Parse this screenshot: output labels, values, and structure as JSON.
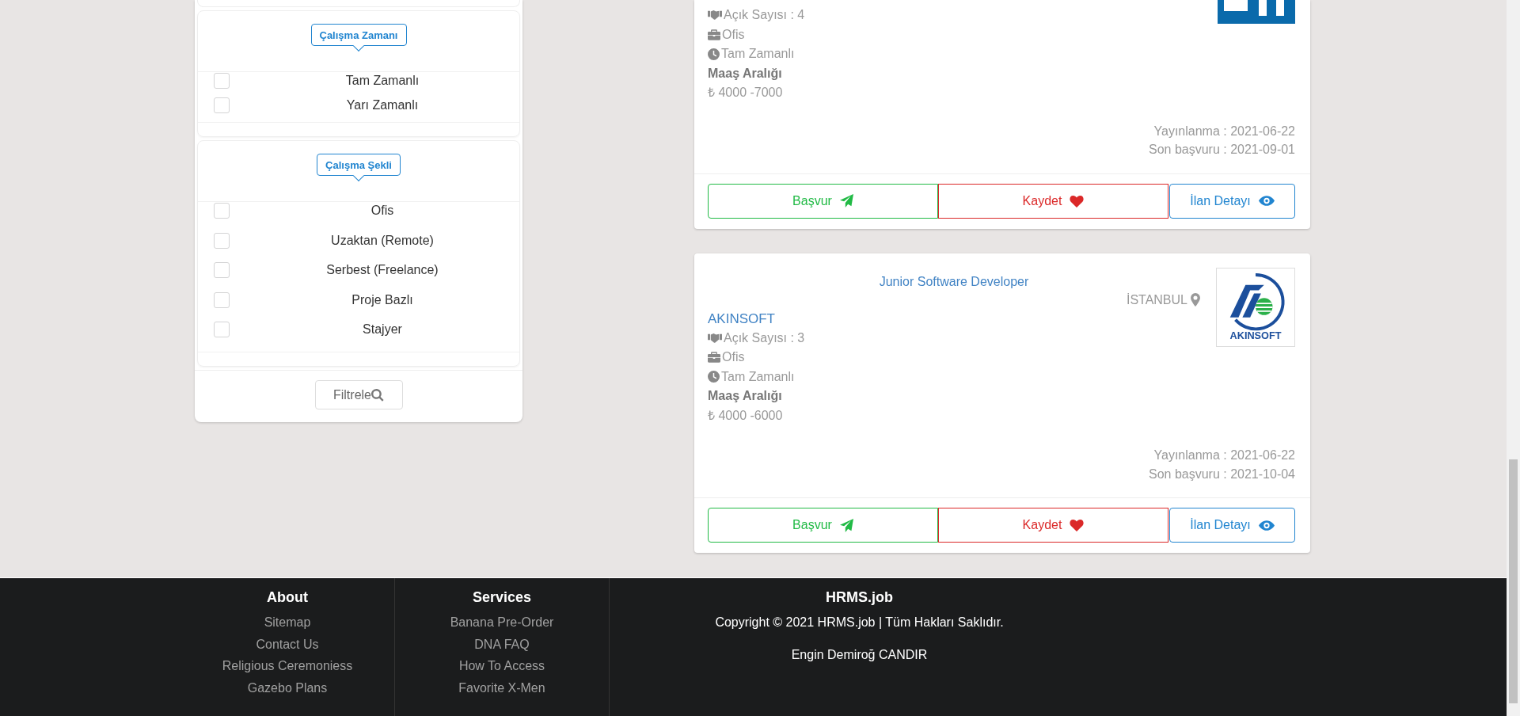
{
  "filters": {
    "sections": [
      {
        "title": "Çalışma Zamanı",
        "options": [
          {
            "label": "Tam Zamanlı",
            "checked": false
          },
          {
            "label": "Yarı Zamanlı",
            "checked": false
          }
        ]
      },
      {
        "title": "Çalışma Şekli",
        "options": [
          {
            "label": "Ofis",
            "checked": false
          },
          {
            "label": "Uzaktan (Remote)",
            "checked": false
          },
          {
            "label": "Serbest (Freelance)",
            "checked": false
          },
          {
            "label": "Proje Bazlı",
            "checked": false
          },
          {
            "label": "Stajyer",
            "checked": false
          }
        ]
      }
    ],
    "filter_button": "Filtrele"
  },
  "jobs": [
    {
      "logo": {
        "kind": "cut"
      },
      "open_positions": "Açık Sayısı : 4",
      "workplace": "Ofis",
      "work_time": "Tam Zamanlı",
      "salary_label": "Maaş Aralığı",
      "salary": "₺ 4000 -7000",
      "published": "Yayınlanma : 2021-06-22",
      "deadline": "Son başvuru : 2021-09-01",
      "buttons": {
        "apply": "Başvur",
        "save": "Kaydet",
        "detail": "İlan Detayı"
      }
    },
    {
      "title": "Junior Software Developer",
      "location": "İSTANBUL",
      "company": "AKINSOFT",
      "logo": {
        "kind": "emblem",
        "text": "AKINSOFT"
      },
      "open_positions": "Açık Sayısı : 3",
      "workplace": "Ofis",
      "work_time": "Tam Zamanlı",
      "salary_label": "Maaş Aralığı",
      "salary": "₺ 4000 -6000",
      "published": "Yayınlanma : 2021-06-22",
      "deadline": "Son başvuru : 2021-10-04",
      "buttons": {
        "apply": "Başvur",
        "save": "Kaydet",
        "detail": "İlan Detayı"
      }
    }
  ],
  "footer": {
    "columns": [
      {
        "title": "About",
        "links": [
          "Sitemap",
          "Contact Us",
          "Religious Ceremoniess",
          "Gazebo Plans"
        ]
      },
      {
        "title": "Services",
        "links": [
          "Banana Pre-Order",
          "DNA FAQ",
          "How To Access",
          "Favorite X-Men"
        ]
      }
    ],
    "brand": {
      "title": "HRMS.job",
      "copyright": "Copyright © 2021 HRMS.job | Tüm Hakları Saklıdır.",
      "author": "Engin Demiroğ CANDIR"
    }
  }
}
